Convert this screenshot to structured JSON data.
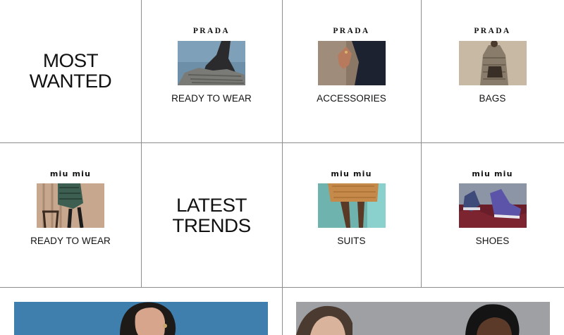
{
  "tiles": {
    "most_wanted": "MOST\nWANTED",
    "latest_trends": "LATEST\nTRENDS"
  },
  "row1": [
    {
      "brand": "PRADA",
      "label": "READY TO WEAR"
    },
    {
      "brand": "PRADA",
      "label": "ACCESSORIES"
    },
    {
      "brand": "PRADA",
      "label": "BAGS"
    }
  ],
  "row2": [
    {
      "brand": "miu miu",
      "label": "READY TO WEAR"
    },
    {
      "brand": "miu miu",
      "label": "SUITS"
    },
    {
      "brand": "miu miu",
      "label": "SHOES"
    }
  ],
  "colors": {
    "grid_line": "#8d8d8d",
    "banner_left_bg": "#3f7fae",
    "banner_right_bg": "#9ea0a4"
  }
}
